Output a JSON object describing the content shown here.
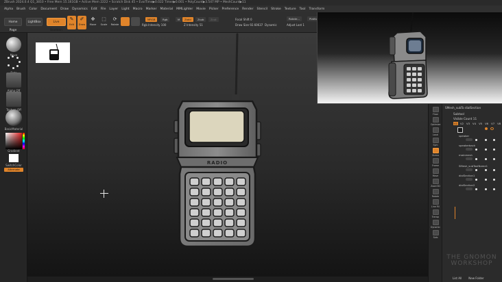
{
  "app": {
    "title_bar": "ZBrush 2024.0.4 Q1_3810      • Free Mem 15.161GB • Active Mem 2222 • Scratch Disk 45 • EvalTime▶0.022 Timer▶0.001 • PolyCount▶3.547 MP • MeshCount▶11"
  },
  "menu": [
    "Alpha",
    "Brush",
    "Color",
    "Document",
    "Draw",
    "Dynamics",
    "Edit",
    "File",
    "Layer",
    "Light",
    "Macro",
    "Marker",
    "Material",
    "MMLighter",
    "Movie",
    "Picker",
    "Preference",
    "Render",
    "Stencil",
    "Stroke",
    "Texture",
    "Tool",
    "Transform"
  ],
  "toolbar": {
    "home_page": "Home Page",
    "lightbox": "LightBox",
    "live_boolean": "Live Boolean",
    "tools": [
      {
        "label": "Edit",
        "active": true
      },
      {
        "label": "Draw",
        "active": true
      },
      {
        "label": "Move",
        "active": false
      },
      {
        "label": "Scale",
        "active": false
      },
      {
        "label": "Rotate",
        "active": false
      }
    ],
    "mrgb": "MRGB",
    "rgb": "Rgb",
    "m": "M",
    "zadd": "Zadd",
    "zsub": "Zsub",
    "zcut": "Zcut",
    "rgb_intensity": "Rgb Intensity 100",
    "z_intensity": "Z Intensity 51",
    "focal_shift": "Focal Shift 0",
    "draw_size": "Draw Size 92.60637",
    "dynamic": "Dynamic",
    "rotate_btn": "Rotate...",
    "adjust_last": "Adjust Last 1",
    "platform": "Platfor",
    "rgb_label": "Rgb"
  },
  "left_shelf": {
    "brush": "Move",
    "stroke": "Dots",
    "alpha": "Alpha Off",
    "texture": "Texture Off",
    "material": "BasicMaterial",
    "gradient": "Gradient",
    "switch_color": "SwitchColor",
    "alternate": "Alternate"
  },
  "right_strip": [
    {
      "label": "Floor",
      "active": false
    },
    {
      "label": "Optimize",
      "active": false
    },
    {
      "label": "Local",
      "active": false
    },
    {
      "label": "Sym",
      "active": false
    },
    {
      "label": "Gizmo",
      "active": true
    },
    {
      "label": "Frame",
      "active": false
    },
    {
      "label": "Move",
      "active": false
    },
    {
      "label": "Zoom3D",
      "active": false
    },
    {
      "label": "Rotate",
      "active": false
    },
    {
      "label": "Line Fill",
      "active": false
    },
    {
      "label": "Transp",
      "active": false
    },
    {
      "label": "Dynamic",
      "active": false
    },
    {
      "label": "Solo",
      "active": false
    }
  ],
  "subtool": {
    "breadcrumb": "SMesh_subTo   dialSection",
    "title": "Subtool",
    "visible_count": "Visible Count 11",
    "versions": [
      "V1",
      "V2",
      "V3",
      "V4",
      "V5",
      "V6",
      "V7",
      "V8"
    ],
    "items": [
      "speaker",
      "speakerback",
      "mainmesh",
      "SMesh_subToolName1",
      "dialSection1",
      "dialSection2"
    ]
  },
  "footer": {
    "list_all": "List All",
    "new_folder": "New Folder"
  },
  "watermark": {
    "line1": "THE GNOMON",
    "line2": "WORKSHOP"
  }
}
